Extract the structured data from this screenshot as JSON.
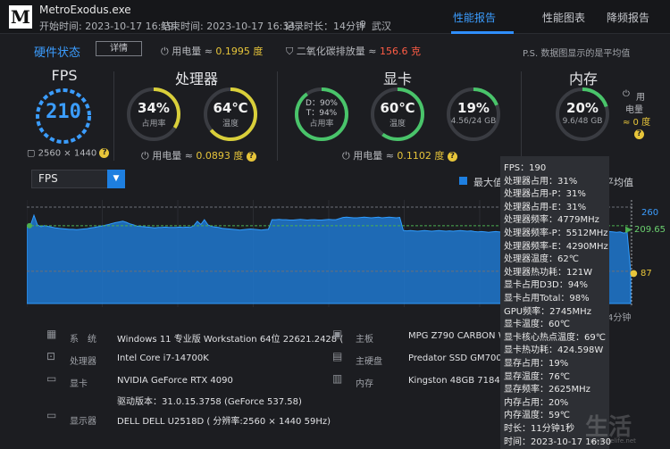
{
  "header": {
    "logo": "M",
    "app_title": "MetroExodus.exe",
    "start_time": "开始时间: 2023-10-17 16:19",
    "end_time": "结束时间: 2023-10-17 16:34",
    "duration": "记录时长：14分钟",
    "location": "武汉",
    "tabs": [
      {
        "label": "性能报告",
        "active": true
      },
      {
        "label": "性能图表",
        "active": false
      },
      {
        "label": "降频报告",
        "active": false
      }
    ]
  },
  "status": {
    "title": "硬件状态",
    "detail_button": "详情",
    "power_label": "用电量 ≈",
    "power_value": "0.1995 度",
    "co2_label": "二氧化碳排放量 ≈",
    "co2_value": "156.6 克",
    "note": "P.S. 数据图显示的是平均值"
  },
  "fps": {
    "title": "FPS",
    "value": "210",
    "resolution": "2560 × 1440"
  },
  "cpu": {
    "title": "处理器",
    "usage_value": "34%",
    "usage_label": "占用率",
    "temp_value": "64℃",
    "temp_label": "温度",
    "power_label": "用电量 ≈",
    "power_value": "0.0893 度"
  },
  "gpu": {
    "title": "显卡",
    "d_value": "D：90%",
    "t_value": "T：94%",
    "usage_label": "占用率",
    "temp_value": "60℃",
    "temp_label": "温度",
    "vram_value": "19%",
    "vram_sub": "4.56/24 GB",
    "power_label": "用电量 ≈",
    "power_value": "0.1102 度"
  },
  "memory": {
    "title": "内存",
    "usage_value": "20%",
    "usage_sub": "9.6/48 GB",
    "power_line1": "用",
    "power_line2": "电量",
    "power_value": "≈ 0 度"
  },
  "chart": {
    "selected_metric": "FPS",
    "legend_max": "最大值",
    "legend_avg": "平均值",
    "y_max_label": "260",
    "y_avg_label": "209.65",
    "y_min_label": "87",
    "x_end_label": "4分钟"
  },
  "chart_data": {
    "type": "area",
    "title": "",
    "xlabel": "",
    "ylabel": "FPS",
    "ylim": [
      0,
      260
    ],
    "reference_lines": {
      "max": 260,
      "avg": 209.65,
      "min": 87
    },
    "series": [
      {
        "values": [
          205,
          210,
          238,
          212,
          207,
          210,
          208,
          206,
          204,
          203,
          202,
          201,
          200,
          200,
          199,
          200,
          201,
          202,
          204,
          205,
          207,
          209,
          211,
          213,
          216,
          218,
          220,
          222,
          219,
          215,
          212,
          209,
          208,
          207,
          206,
          205,
          204,
          205,
          205,
          206,
          205,
          205,
          205,
          206,
          205,
          206,
          205,
          210,
          222,
          213,
          226,
          212,
          208,
          206,
          205,
          203,
          202,
          201,
          200,
          199,
          198,
          199,
          200,
          201,
          200,
          199,
          198,
          199,
          200,
          226,
          226,
          227,
          226,
          226,
          225,
          225,
          226,
          227,
          226,
          225,
          226,
          226,
          225,
          225,
          226,
          227,
          226,
          226,
          229,
          232,
          233,
          232,
          231,
          231,
          232,
          233,
          232,
          231,
          232,
          233,
          231,
          232,
          233,
          232,
          231,
          232,
          197,
          196,
          197,
          196,
          195,
          196,
          197,
          196,
          195,
          196,
          197,
          196,
          195,
          196,
          195,
          196,
          197,
          196,
          195,
          196,
          194,
          193,
          194,
          193,
          192,
          193,
          194,
          193,
          192,
          193,
          194,
          193,
          192,
          193,
          194,
          193,
          192,
          193,
          194,
          193,
          192,
          193,
          194,
          193,
          192,
          193,
          194,
          193,
          192,
          193,
          194,
          193,
          192,
          193,
          194,
          193,
          192,
          193,
          194,
          193,
          192,
          193,
          190,
          192,
          87
        ]
      }
    ]
  },
  "tooltip": {
    "lines": [
      "FPS：190",
      "处理器占用：31%",
      "处理器占用-P：31%",
      "处理器占用-E：31%",
      "处理器频率：4779MHz",
      "处理器频率-P：5512MHz",
      "处理器频率-E：4290MHz",
      "处理器温度：62℃",
      "处理器热功耗：121W",
      "显卡占用D3D：94%",
      "显卡占用Total：98%",
      "GPU频率：2745MHz",
      "显卡温度：60℃",
      "显卡核心热点温度：69℃",
      "显卡热功耗：424.598W",
      "显存占用：19%",
      "显存温度：76℃",
      "显存频率：2625MHz",
      "内存占用：20%",
      "内存温度：59℃",
      "时长：11分钟1秒",
      "时间：2023-10-17 16:30"
    ]
  },
  "sysinfo": {
    "system_label": "系　统",
    "system_value": "Windows 11 专业版 Workstation 64位 22621.2428 (",
    "cpu_label": "处理器",
    "cpu_value": "Intel Core i7-14700K",
    "gpu_label": "显卡",
    "gpu_value": "NVIDIA GeForce RTX 4090",
    "driver_value": "驱动版本：31.0.15.3758 (GeForce 537.58)",
    "monitor_label": "显示器",
    "monitor_value": "DELL DELL U2518D ( 分辨率:2560 × 1440 59Hz)",
    "board_label": "主板",
    "board_value": "MPG Z790 CARBON W",
    "disk_label": "主硬盘",
    "disk_value": "Predator SSD GM7000",
    "mem_label": "内存",
    "mem_value": "Kingston 48GB 7184M"
  },
  "watermark": {
    "text": "生活",
    "sub": "www.3elife.net"
  },
  "colors": {
    "accent": "#2f8fff",
    "gauge_blue": "#3b9dff",
    "gauge_yellow": "#d9cf3a",
    "gauge_green": "#49c46a",
    "avg_line": "#4caf50",
    "area_fill": "#1e7fd6"
  }
}
